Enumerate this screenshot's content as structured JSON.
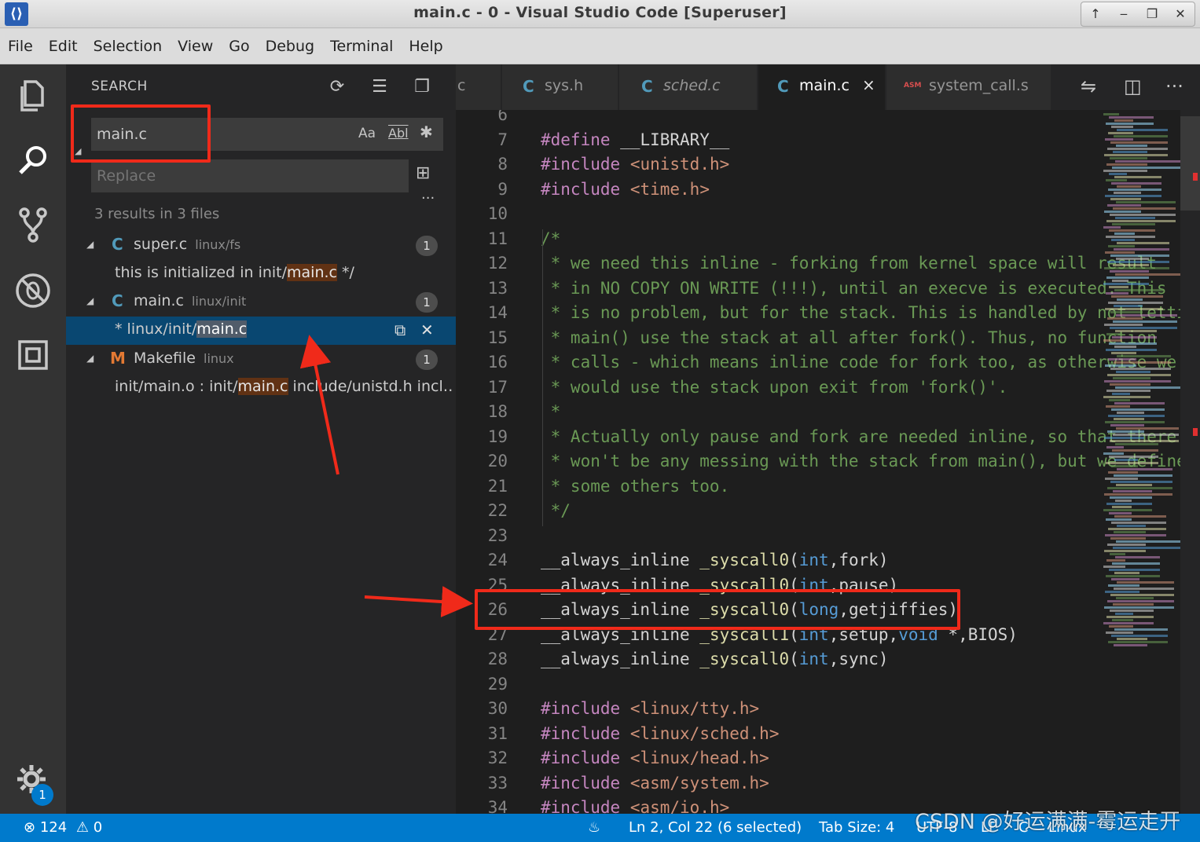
{
  "window": {
    "title": "main.c - 0 - Visual Studio Code [Superuser]",
    "controls": [
      "↑",
      "‒",
      "❐",
      "✕"
    ]
  },
  "menu": [
    "File",
    "Edit",
    "Selection",
    "View",
    "Go",
    "Debug",
    "Terminal",
    "Help"
  ],
  "activity": {
    "icons": [
      "files-icon",
      "search-icon",
      "source-control-icon",
      "debug-icon",
      "extensions-icon",
      "settings-gear-icon"
    ],
    "badge": "1"
  },
  "search": {
    "header": "SEARCH",
    "query": "main.c",
    "replace_placeholder": "Replace",
    "case_label": "Aa",
    "word_label": "Abl",
    "more": "···",
    "summary": "3 results in 3 files",
    "groups": [
      {
        "icon": "C",
        "file": "super.c",
        "path": "linux/fs",
        "count": "1",
        "match_pre": "this is initialized in init/",
        "match": "main.c",
        "match_post": " */"
      },
      {
        "icon": "C",
        "file": "main.c",
        "path": "linux/init",
        "count": "1",
        "match_pre": "* linux/init/",
        "match": "main.c",
        "match_post": ""
      },
      {
        "icon": "M",
        "file": "Makefile",
        "path": "linux",
        "count": "1",
        "match_pre": "init/main.o : init/",
        "match": "main.c",
        "match_post": " include/unistd.h incl…"
      }
    ]
  },
  "tabs": [
    {
      "label": "c",
      "icon": ""
    },
    {
      "label": "sys.h",
      "icon": "C"
    },
    {
      "label": "sched.c",
      "icon": "C"
    },
    {
      "label": "main.c",
      "icon": "C",
      "active": true,
      "close": "×"
    },
    {
      "label": "system_call.s",
      "icon": "ASM"
    }
  ],
  "editor": {
    "lines": [
      {
        "n": "6",
        "t": ""
      },
      {
        "n": "7",
        "t": "#define __LIBRARY__"
      },
      {
        "n": "8",
        "t": "#include <unistd.h>"
      },
      {
        "n": "9",
        "t": "#include <time.h>"
      },
      {
        "n": "10",
        "t": ""
      },
      {
        "n": "11",
        "t": "/*"
      },
      {
        "n": "12",
        "t": " * we need this inline - forking from kernel space will result"
      },
      {
        "n": "13",
        "t": " * in NO COPY ON WRITE (!!!), until an execve is executed. This"
      },
      {
        "n": "14",
        "t": " * is no problem, but for the stack. This is handled by not letting"
      },
      {
        "n": "15",
        "t": " * main() use the stack at all after fork(). Thus, no function"
      },
      {
        "n": "16",
        "t": " * calls - which means inline code for fork too, as otherwise we"
      },
      {
        "n": "17",
        "t": " * would use the stack upon exit from 'fork()'."
      },
      {
        "n": "18",
        "t": " *"
      },
      {
        "n": "19",
        "t": " * Actually only pause and fork are needed inline, so that there"
      },
      {
        "n": "20",
        "t": " * won't be any messing with the stack from main(), but we define"
      },
      {
        "n": "21",
        "t": " * some others too."
      },
      {
        "n": "22",
        "t": " */"
      },
      {
        "n": "23",
        "t": ""
      },
      {
        "n": "24",
        "t": "__always_inline _syscall0(int,fork)"
      },
      {
        "n": "25",
        "t": "__always_inline _syscall0(int,pause)"
      },
      {
        "n": "26",
        "t": "__always_inline _syscall0(long,getjiffies)"
      },
      {
        "n": "27",
        "t": "__always_inline _syscall1(int,setup,void *,BIOS)"
      },
      {
        "n": "28",
        "t": "__always_inline _syscall0(int,sync)"
      },
      {
        "n": "29",
        "t": ""
      },
      {
        "n": "30",
        "t": "#include <linux/tty.h>"
      },
      {
        "n": "31",
        "t": "#include <linux/sched.h>"
      },
      {
        "n": "32",
        "t": "#include <linux/head.h>"
      },
      {
        "n": "33",
        "t": "#include <asm/system.h>"
      },
      {
        "n": "34",
        "t": "#include <asm/io.h>"
      }
    ]
  },
  "status": {
    "errors": "124",
    "warnings": "0",
    "position": "Ln 2, Col 22 (6 selected)",
    "tab_size": "Tab Size: 4",
    "encoding": "UTF-8",
    "eol": "LF",
    "language": "C",
    "platform": "Linux"
  },
  "watermark": "CSDN @好运满满-霉运走开",
  "colors": {
    "accent": "#007acc",
    "annotation": "#f02a1a",
    "match_highlight": "#613214"
  }
}
